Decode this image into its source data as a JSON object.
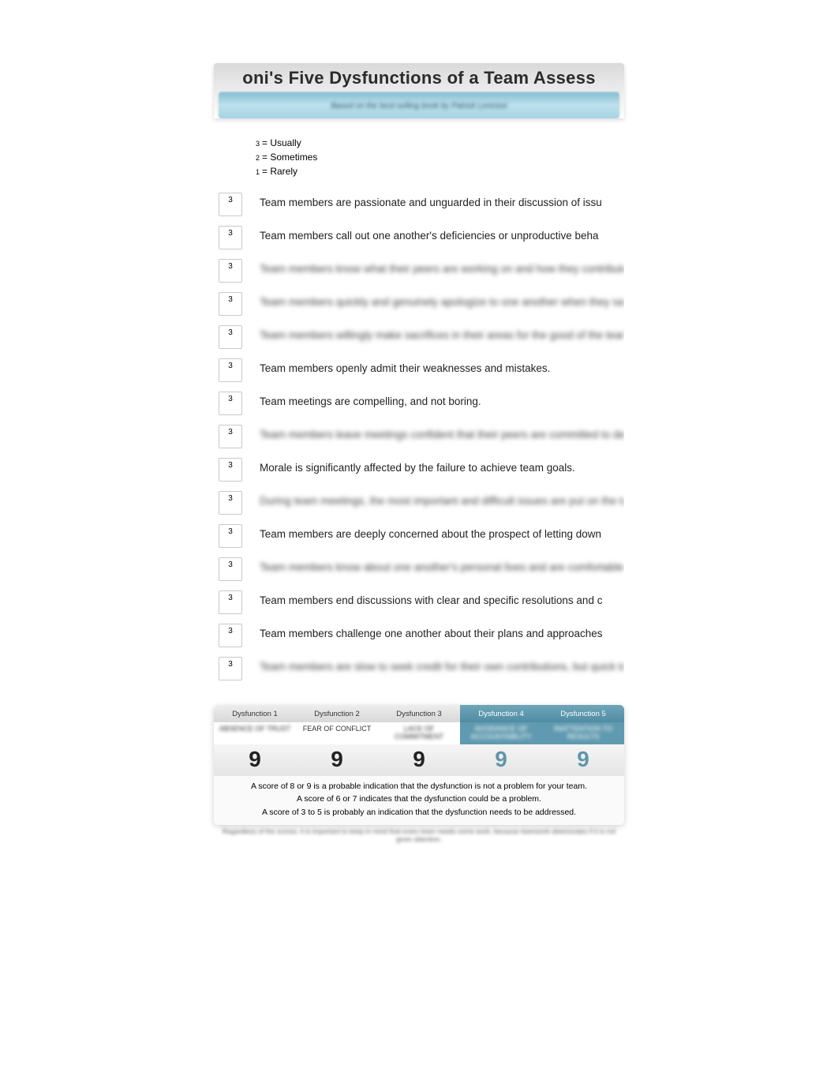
{
  "header": {
    "title": "oni's Five Dysfunctions of a Team Assess",
    "subtitle_blurred": "Based on the best-selling book by Patrick Lencioni"
  },
  "legend": [
    {
      "num": "3",
      "label": "= Usually"
    },
    {
      "num": "2",
      "label": "= Sometimes"
    },
    {
      "num": "1",
      "label": "= Rarely"
    }
  ],
  "questions": [
    {
      "score": "3",
      "text": "Team members are passionate and unguarded in their discussion of issu",
      "blurred": false
    },
    {
      "score": "3",
      "text": "Team members call out one another's deficiencies or unproductive beha",
      "blurred": false
    },
    {
      "score": "3",
      "text": "Team members know what their peers are working on and how they contribute to the collective good of the team.",
      "blurred": true
    },
    {
      "score": "3",
      "text": "Team members quickly and genuinely apologize to one another when they say or do something inappropriate.",
      "blurred": true
    },
    {
      "score": "3",
      "text": "Team members willingly make sacrifices in their areas for the good of the team.",
      "blurred": true
    },
    {
      "score": "3",
      "text": "Team members openly admit their weaknesses and mistakes.",
      "blurred": false
    },
    {
      "score": "3",
      "text": "Team meetings are compelling, and not boring.",
      "blurred": false
    },
    {
      "score": "3",
      "text": "Team members leave meetings confident that their peers are committed to decisions even if there was disagreement.",
      "blurred": true
    },
    {
      "score": "3",
      "text": "Morale is significantly affected by the failure to achieve team goals.",
      "blurred": false
    },
    {
      "score": "3",
      "text": "During team meetings, the most important and difficult issues are put on the table to be resolved.",
      "blurred": true
    },
    {
      "score": "3",
      "text": "Team members are deeply concerned about the prospect of letting down",
      "blurred": false
    },
    {
      "score": "3",
      "text": "Team members know about one another's personal lives and are comfortable discussing them.",
      "blurred": true
    },
    {
      "score": "3",
      "text": "Team members end discussions with clear and specific resolutions and c",
      "blurred": false
    },
    {
      "score": "3",
      "text": "Team members challenge one another about their plans and approaches",
      "blurred": false
    },
    {
      "score": "3",
      "text": "Team members are slow to seek credit for their own contributions, but quick to point out those of others.",
      "blurred": true
    }
  ],
  "results": {
    "columns": [
      {
        "label": "Dysfunction 1",
        "sub": "ABSENCE OF TRUST",
        "score": "9",
        "style": "light",
        "sub_blurred": true
      },
      {
        "label": "Dysfunction 2",
        "sub": "FEAR OF CONFLICT",
        "score": "9",
        "style": "light",
        "sub_blurred": false
      },
      {
        "label": "Dysfunction 3",
        "sub": "LACK OF COMMITMENT",
        "score": "9",
        "style": "light",
        "sub_blurred": true
      },
      {
        "label": "Dysfunction 4",
        "sub": "AVOIDANCE OF ACCOUNTABILITY",
        "score": "9",
        "style": "dark",
        "sub_blurred": true
      },
      {
        "label": "Dysfunction 5",
        "sub": "INATTENTION TO RESULTS",
        "score": "9",
        "style": "dark",
        "sub_blurred": true
      }
    ],
    "interpretation": [
      "A score of 8 or 9 is a probable indication that the dysfunction is not a problem for your team.",
      "A score of 6 or 7 indicates that the dysfunction could be a problem.",
      "A score of 3 to 5 is probably an indication that the dysfunction needs to be addressed."
    ],
    "footnote_blurred": "Regardless of the scores, it is important to keep in mind that every team needs some work, because teamwork deteriorates if it is not given attention."
  }
}
